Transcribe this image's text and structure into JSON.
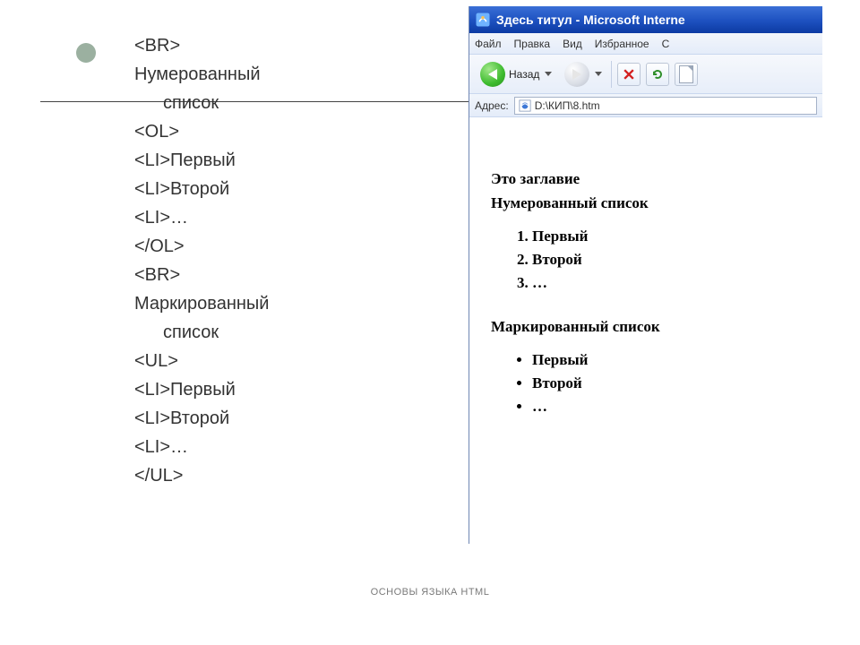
{
  "left": {
    "lines": {
      "l01": "<BR>",
      "l02": "Нумерованный",
      "l03": "список",
      "l04": "<OL>",
      "l05": "<LI>Первый",
      "l06": "<LI>Второй",
      "l07": "<LI>…",
      "l08": "</OL>",
      "l09": "<BR>",
      "l10": "Маркированный",
      "l11": "список",
      "l12": "<UL>",
      "l13": "<LI>Первый",
      "l14": "<LI>Второй",
      "l15": "<LI>…",
      "l16": "</UL>"
    }
  },
  "browser": {
    "title": "Здесь титул - Microsoft Interne",
    "menu": {
      "file": "Файл",
      "edit": "Правка",
      "view": "Вид",
      "favorites": "Избранное",
      "extra": "С"
    },
    "toolbar": {
      "back": "Назад"
    },
    "addr": {
      "label": "Адрес:",
      "value": "D:\\КИП\\8.htm"
    }
  },
  "page": {
    "heading": "Это заглавие",
    "num_title": "Нумерованный список",
    "ol": {
      "i1": "Первый",
      "i2": "Второй",
      "i3": "…"
    },
    "bul_title": "Маркированный список",
    "ul": {
      "i1": "Первый",
      "i2": "Второй",
      "i3": "…"
    }
  },
  "footer": "ОСНОВЫ ЯЗЫКА HTML"
}
